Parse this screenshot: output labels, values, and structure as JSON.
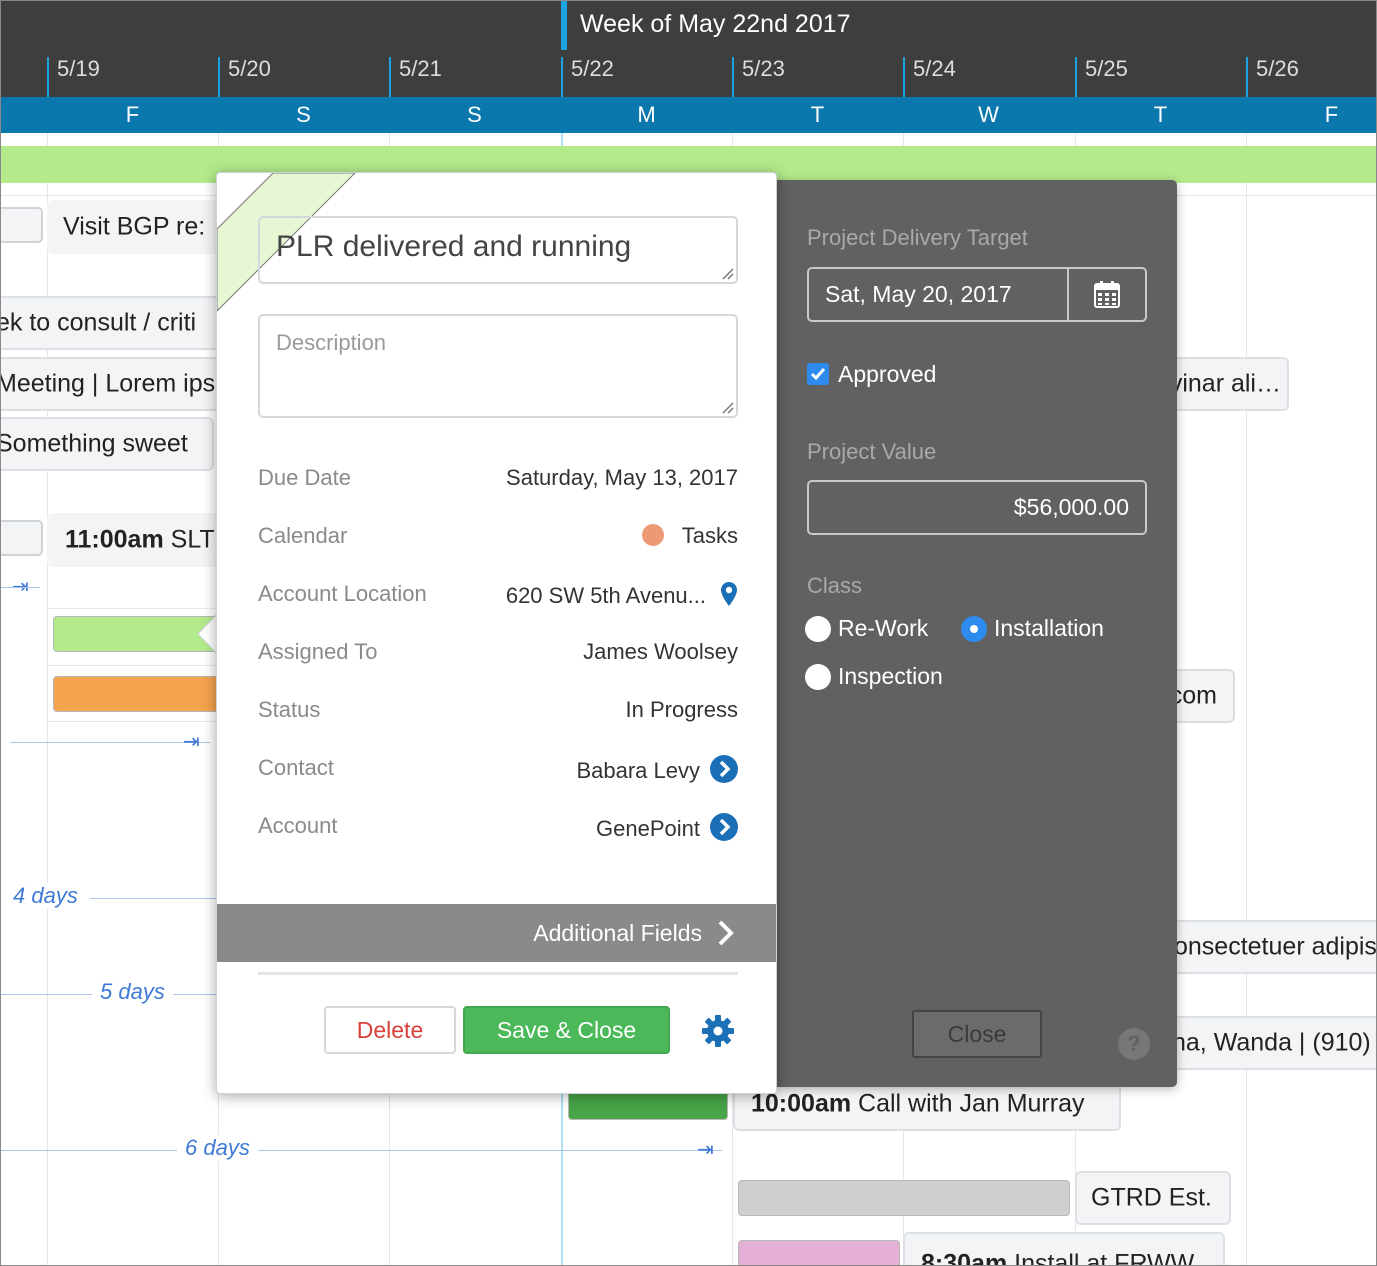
{
  "header": {
    "week_title": "Week of May 22nd 2017",
    "dates": [
      "5/19",
      "5/20",
      "5/21",
      "5/22",
      "5/23",
      "5/24",
      "5/25",
      "5/26"
    ],
    "days": [
      "F",
      "S",
      "S",
      "M",
      "T",
      "W",
      "T",
      "F"
    ],
    "accent_color": "#1aa5e0",
    "day_bar_color": "#0a77ad"
  },
  "background_events": {
    "visit": "Visit BGP re:",
    "consult": "ek to consult / criti",
    "meeting": "Meeting | Lorem ips",
    "sweet": "Something sweet",
    "slt_time": "11:00am",
    "slt_text": "SLT",
    "vinar": "vinar ali…",
    "com": "com",
    "consectetuer": "onsectetuer adipis",
    "wanda": "na, Wanda | (910)",
    "call_time": "10:00am",
    "call_text": "Call with Jan Murray",
    "gtrd": "GTRD Est.",
    "install_time": "8:30am",
    "install_text": "Install at FRWW",
    "durations": [
      "4 days",
      "5 days",
      "6 days"
    ]
  },
  "popup": {
    "title": "PLR delivered and running",
    "description_placeholder": "Description",
    "fields": [
      {
        "label": "Due Date",
        "value": "Saturday, May 13, 2017"
      },
      {
        "label": "Calendar",
        "value": "Tasks"
      },
      {
        "label": "Account Location",
        "value": "620 SW 5th Avenu..."
      },
      {
        "label": "Assigned To",
        "value": "James Woolsey"
      },
      {
        "label": "Status",
        "value": "In Progress"
      },
      {
        "label": "Contact",
        "value": "Babara Levy"
      },
      {
        "label": "Account",
        "value": "GenePoint"
      }
    ],
    "calendar_color": "#ec9a76",
    "additional_fields": "Additional Fields",
    "delete_label": "Delete",
    "save_label": "Save & Close"
  },
  "side_panel": {
    "delivery_label": "Project Delivery Target",
    "delivery_value": "Sat, May 20, 2017",
    "approved_label": "Approved",
    "approved": true,
    "value_label": "Project Value",
    "value": "$56,000.00",
    "class_label": "Class",
    "class_options": [
      "Re-Work",
      "Installation",
      "Inspection"
    ],
    "class_selected": "Installation",
    "close_label": "Close",
    "help_icon": "?"
  }
}
